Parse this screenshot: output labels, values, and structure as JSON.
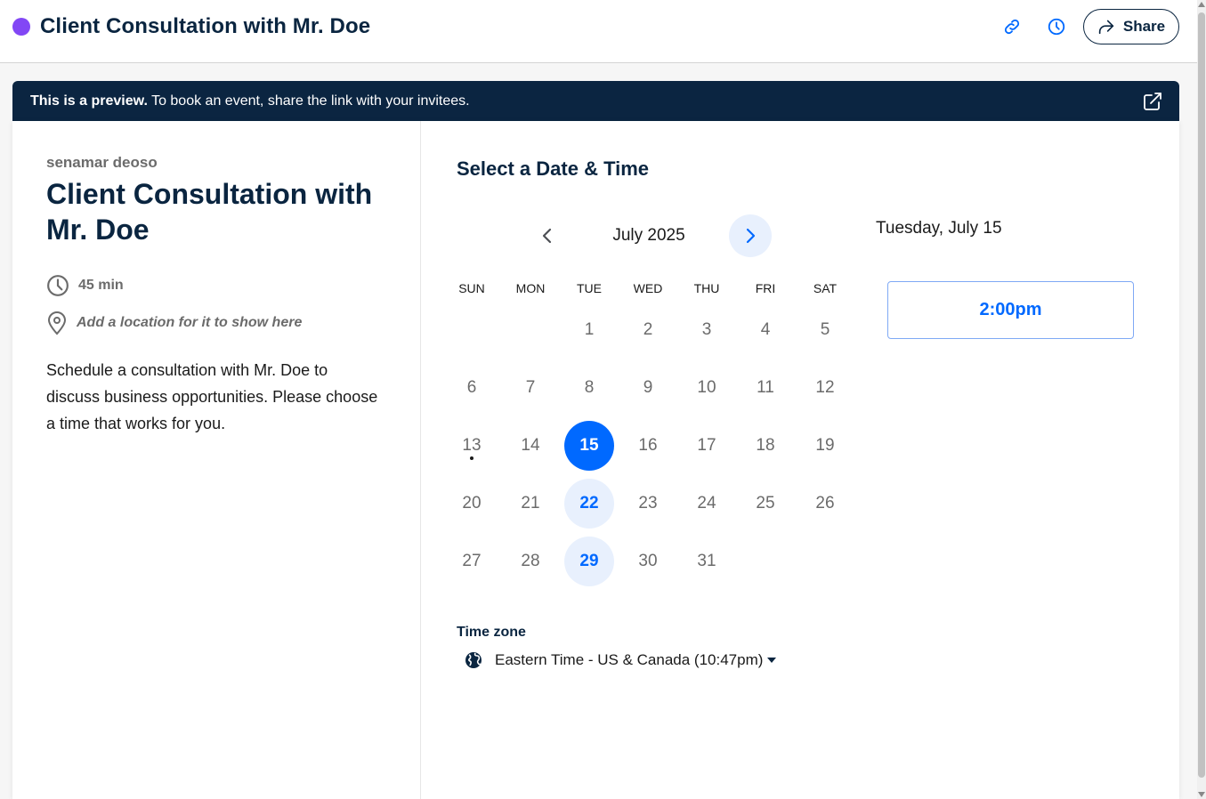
{
  "header": {
    "title": "Client Consultation with Mr. Doe",
    "event_color": "#8247f5",
    "copy_link_icon": "link-icon",
    "schedule_icon": "clock-icon",
    "share_label": "Share"
  },
  "banner": {
    "bold": "This is a preview.",
    "text": " To book an event, share the link with your invitees.",
    "open_icon": "external-link-icon"
  },
  "event": {
    "owner": "senamar deoso",
    "title": "Client Consultation with Mr. Doe",
    "duration": "45 min",
    "location_hint": "Add a location for it to show here",
    "description": "Schedule a consultation with Mr. Doe to discuss business opportunities. Please choose a time that works for you."
  },
  "scheduler": {
    "heading": "Select a Date & Time",
    "month": "July 2025",
    "weekdays": [
      "SUN",
      "MON",
      "TUE",
      "WED",
      "THU",
      "FRI",
      "SAT"
    ],
    "first_weekday_index": 2,
    "days_in_month": 31,
    "available_days": [
      15,
      22,
      29
    ],
    "selected_day": 15,
    "today": 13,
    "timezone_label": "Time zone",
    "timezone_value": "Eastern Time - US & Canada (10:47pm)",
    "selected_date_label": "Tuesday, July 15",
    "time_slots": [
      "2:00pm"
    ]
  },
  "colors": {
    "primary": "#0069ff",
    "navy": "#0b2541",
    "available_bg": "#e8f0fd"
  }
}
